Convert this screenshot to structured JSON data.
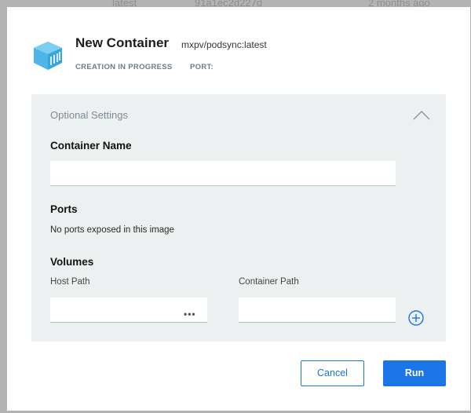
{
  "background": {
    "row": [
      "latest",
      "91a1ec2d227d",
      "2 months ago"
    ]
  },
  "dialog": {
    "title": "New Container",
    "image": "mxpv/podsync:latest",
    "status": "CREATION IN PROGRESS",
    "port_label": "PORT:",
    "icon": "container-box-icon",
    "accent_color": "#1c75e8",
    "icon_color": "#4fb5e8"
  },
  "settings": {
    "title": "Optional Settings",
    "collapse_icon": "chevron-up-icon",
    "container_name": {
      "label": "Container Name",
      "value": ""
    },
    "ports": {
      "label": "Ports",
      "message": "No ports exposed in this image"
    },
    "volumes": {
      "label": "Volumes",
      "host_path_label": "Host Path",
      "host_path_value": "",
      "browse_label": "•••",
      "container_path_label": "Container Path",
      "container_path_value": "",
      "add_icon": "plus-circle-icon"
    }
  },
  "actions": {
    "cancel": "Cancel",
    "run": "Run"
  }
}
